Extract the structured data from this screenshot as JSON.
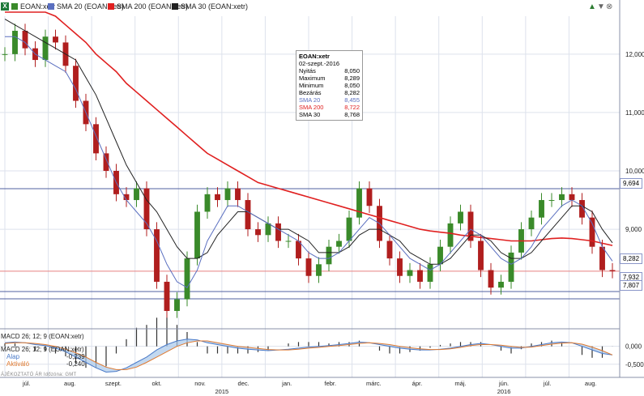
{
  "toolbar": {
    "excel_label": "X",
    "symbol": "EOAN:xetr",
    "sma20": "SMA 20 (EOAN:xetr)",
    "sma200": "SMA 200 (EOAN:xetr)",
    "sma30": "SMA 30 (EOAN:xetr)",
    "btn_up": "▲",
    "btn_down": "▼",
    "btn_close": "⊗"
  },
  "colors": {
    "up": "#3a8a2a",
    "down": "#b01e1e",
    "sma20": "#5a6fc0",
    "sma200": "#e02020",
    "sma30": "#222222",
    "grid": "#dde2ec",
    "hline": "#5060a0",
    "refline": "#e88080"
  },
  "tooltip": {
    "title": "EOAN:xetr",
    "date": "02-szept.-2016",
    "rows": [
      {
        "label": "Nyitás",
        "value": "8,050"
      },
      {
        "label": "Maximum",
        "value": "8,289"
      },
      {
        "label": "Minimum",
        "value": "8,050"
      },
      {
        "label": "Bezárás",
        "value": "8,282"
      },
      {
        "label": "SMA 20",
        "value": "8,455"
      },
      {
        "label": "SMA 200",
        "value": "8,722"
      },
      {
        "label": "SMA 30",
        "value": "8,768"
      }
    ]
  },
  "price_tags": {
    "t1": "9,694",
    "t2": "8,282",
    "t3": "7,932",
    "t4": "7,807"
  },
  "y_ticks": [
    "12,000",
    "11,000",
    "10,000",
    "9,000"
  ],
  "macd": {
    "title": "MACD 26; 12; 9 (EOAN:xetr)",
    "header": "MACD 26; 12; 9 (EOAN:xetr)",
    "alap_label": "Alap",
    "alap_value": "-0,239",
    "aktivalo_label": "Aktiváló",
    "aktivalo_value": "-0,240",
    "ticks": [
      "0,000",
      "-0,500"
    ]
  },
  "footnote": "ÁJÉKOZTATÓ ÁR   Időzóna: GMT",
  "x_months": [
    "júl.",
    "aug.",
    "szept.",
    "okt.",
    "nov.",
    "dec.",
    "jan.",
    "febr.",
    "márc.",
    "ápr.",
    "máj.",
    "jún.",
    "júl.",
    "aug."
  ],
  "x_years": [
    "2015",
    "2016"
  ],
  "chart_data": {
    "type": "line",
    "title": "EOAN:xetr",
    "ylim": [
      7.35,
      12.65
    ],
    "macd_ylim": [
      -0.8,
      0.4
    ],
    "h_levels": [
      9.694,
      8.282,
      7.932,
      7.807
    ],
    "months": [
      "2015-07",
      "2015-08",
      "2015-09",
      "2015-10",
      "2015-11",
      "2015-12",
      "2016-01",
      "2016-02",
      "2016-03",
      "2016-04",
      "2016-05",
      "2016-06",
      "2016-07",
      "2016-08"
    ],
    "close": [
      12.0,
      12.4,
      12.1,
      11.9,
      12.3,
      12.2,
      11.8,
      11.2,
      10.8,
      10.3,
      10.0,
      9.6,
      9.5,
      9.7,
      9.0,
      8.1,
      7.6,
      7.8,
      8.5,
      9.3,
      9.6,
      9.5,
      9.7,
      9.5,
      9.0,
      8.9,
      9.1,
      8.8,
      8.8,
      8.5,
      8.2,
      8.4,
      8.7,
      8.8,
      9.2,
      9.7,
      9.4,
      8.8,
      8.5,
      8.2,
      8.3,
      8.1,
      8.4,
      8.7,
      9.1,
      9.3,
      8.8,
      8.3,
      8.0,
      8.1,
      8.6,
      9.0,
      9.2,
      9.5,
      9.5,
      9.6,
      9.5,
      9.2,
      8.7,
      8.3,
      8.28
    ],
    "sma20": [
      12.3,
      12.3,
      12.2,
      12.0,
      11.9,
      11.8,
      11.7,
      11.4,
      11.0,
      10.6,
      10.2,
      9.8,
      9.5,
      9.3,
      9.1,
      8.8,
      8.4,
      8.1,
      8.0,
      8.3,
      8.8,
      9.1,
      9.4,
      9.4,
      9.3,
      9.2,
      9.1,
      9.0,
      8.9,
      8.8,
      8.6,
      8.5,
      8.5,
      8.6,
      8.8,
      9.0,
      9.2,
      9.1,
      8.9,
      8.7,
      8.5,
      8.4,
      8.3,
      8.4,
      8.6,
      8.8,
      9.0,
      8.9,
      8.7,
      8.5,
      8.4,
      8.5,
      8.7,
      9.0,
      9.2,
      9.4,
      9.5,
      9.4,
      9.1,
      8.7,
      8.455
    ],
    "sma30": [
      12.6,
      12.5,
      12.4,
      12.3,
      12.2,
      12.1,
      12.0,
      11.9,
      11.6,
      11.3,
      10.9,
      10.5,
      10.1,
      9.8,
      9.5,
      9.3,
      9.0,
      8.7,
      8.5,
      8.5,
      8.6,
      8.9,
      9.1,
      9.3,
      9.3,
      9.2,
      9.1,
      9.0,
      9.0,
      8.9,
      8.8,
      8.6,
      8.6,
      8.6,
      8.7,
      8.9,
      9.0,
      9.0,
      8.9,
      8.8,
      8.6,
      8.5,
      8.4,
      8.4,
      8.5,
      8.7,
      8.9,
      8.9,
      8.8,
      8.6,
      8.5,
      8.5,
      8.6,
      8.8,
      9.0,
      9.2,
      9.4,
      9.4,
      9.3,
      9.0,
      8.768
    ],
    "sma200": [
      13.2,
      13.1,
      13.0,
      12.9,
      12.8,
      12.65,
      12.5,
      12.35,
      12.2,
      12.0,
      11.85,
      11.7,
      11.5,
      11.35,
      11.2,
      11.05,
      10.9,
      10.75,
      10.6,
      10.45,
      10.3,
      10.2,
      10.1,
      10.0,
      9.9,
      9.8,
      9.75,
      9.7,
      9.65,
      9.6,
      9.55,
      9.5,
      9.45,
      9.4,
      9.35,
      9.3,
      9.25,
      9.2,
      9.15,
      9.1,
      9.05,
      9.0,
      8.97,
      8.95,
      8.93,
      8.9,
      8.88,
      8.86,
      8.84,
      8.82,
      8.8,
      8.8,
      8.8,
      8.82,
      8.84,
      8.85,
      8.84,
      8.82,
      8.8,
      8.76,
      8.722
    ],
    "macd_alap": [
      0.1,
      0.12,
      0.1,
      0.05,
      0.02,
      -0.05,
      -0.15,
      -0.3,
      -0.45,
      -0.6,
      -0.72,
      -0.7,
      -0.6,
      -0.45,
      -0.3,
      -0.1,
      0.05,
      0.15,
      0.2,
      0.18,
      0.1,
      0.05,
      0.0,
      -0.05,
      -0.08,
      -0.1,
      -0.12,
      -0.1,
      -0.08,
      -0.05,
      -0.02,
      0.0,
      0.02,
      0.05,
      0.08,
      0.12,
      0.1,
      0.05,
      0.0,
      -0.05,
      -0.08,
      -0.1,
      -0.1,
      -0.08,
      -0.05,
      0.0,
      0.05,
      0.08,
      0.05,
      0.0,
      -0.05,
      -0.05,
      0.0,
      0.05,
      0.1,
      0.12,
      0.1,
      0.0,
      -0.1,
      -0.2,
      -0.239
    ],
    "macd_aktivalo": [
      0.08,
      0.1,
      0.1,
      0.08,
      0.05,
      0.0,
      -0.08,
      -0.18,
      -0.3,
      -0.45,
      -0.58,
      -0.65,
      -0.65,
      -0.58,
      -0.45,
      -0.3,
      -0.15,
      0.0,
      0.1,
      0.15,
      0.15,
      0.1,
      0.05,
      0.0,
      -0.03,
      -0.06,
      -0.09,
      -0.1,
      -0.1,
      -0.08,
      -0.05,
      -0.03,
      0.0,
      0.02,
      0.05,
      0.08,
      0.1,
      0.08,
      0.05,
      0.0,
      -0.04,
      -0.07,
      -0.09,
      -0.09,
      -0.07,
      -0.03,
      0.02,
      0.05,
      0.05,
      0.03,
      0.0,
      -0.03,
      -0.02,
      0.02,
      0.06,
      0.09,
      0.1,
      0.06,
      -0.02,
      -0.12,
      -0.24
    ]
  }
}
